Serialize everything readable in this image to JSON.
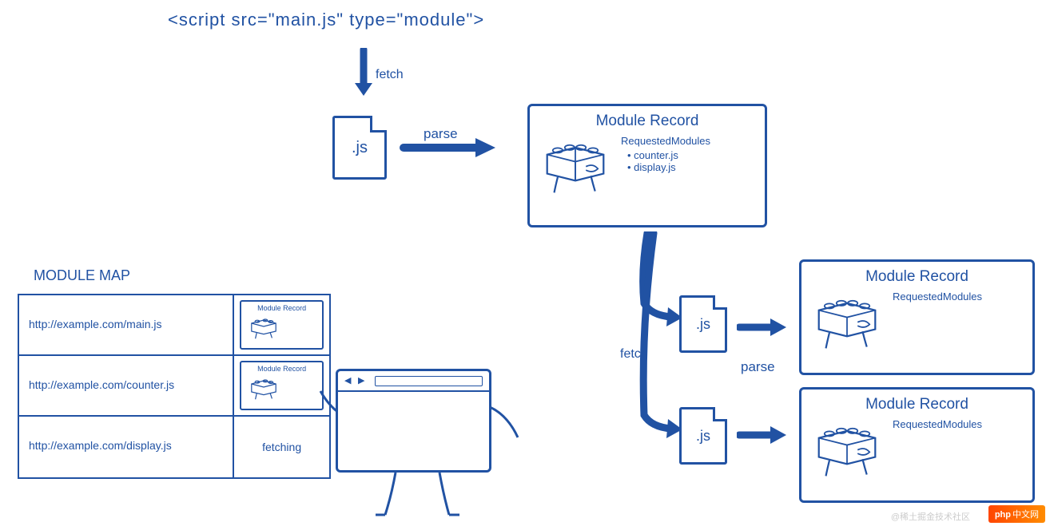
{
  "scriptTag": "<script src=\"main.js\" type=\"module\">",
  "labels": {
    "fetch": "fetch",
    "parse": "parse"
  },
  "jsFileLabel": ".js",
  "moduleRecord": {
    "title": "Module Record",
    "requested": "RequestedModules",
    "items": [
      "counter.js",
      "display.js"
    ]
  },
  "moduleMap": {
    "title": "MODULE MAP",
    "rows": [
      {
        "url": "http://example.com/main.js",
        "status": "record"
      },
      {
        "url": "http://example.com/counter.js",
        "status": "record"
      },
      {
        "url": "http://example.com/display.js",
        "status": "fetching"
      }
    ],
    "fetchingLabel": "fetching"
  },
  "watermark": "@稀土掘金技术社区",
  "badge": {
    "php": "php",
    "cn": "中文网"
  }
}
